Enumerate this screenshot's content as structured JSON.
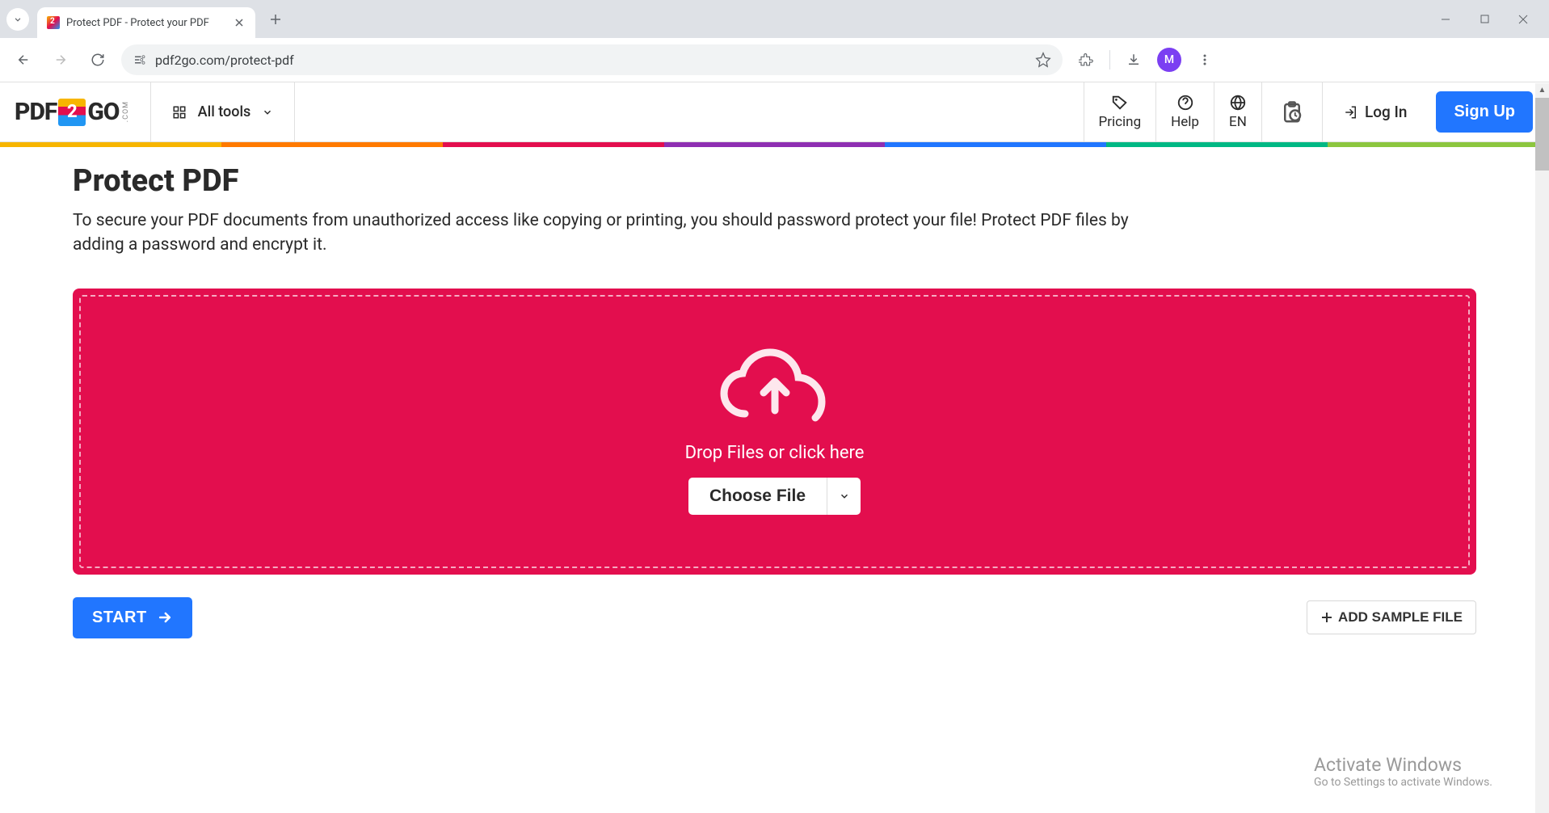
{
  "browser": {
    "tab_title": "Protect PDF - Protect your PDF",
    "url": "pdf2go.com/protect-pdf",
    "profile_initial": "M"
  },
  "header": {
    "logo_pdf": "PDF",
    "logo_2": "2",
    "logo_go": "GO",
    "logo_com": ".COM",
    "all_tools": "All tools",
    "pricing": "Pricing",
    "help": "Help",
    "lang": "EN",
    "login": "Log In",
    "signup": "Sign Up"
  },
  "page": {
    "title": "Protect PDF",
    "description": "To secure your PDF documents from unauthorized access like copying or printing, you should password protect your file! Protect PDF files by adding a password and encrypt it.",
    "drop_text": "Drop Files or click here",
    "choose_file": "Choose File",
    "start": "START",
    "add_sample": "ADD SAMPLE FILE"
  },
  "watermark": {
    "title": "Activate Windows",
    "sub": "Go to Settings to activate Windows."
  }
}
